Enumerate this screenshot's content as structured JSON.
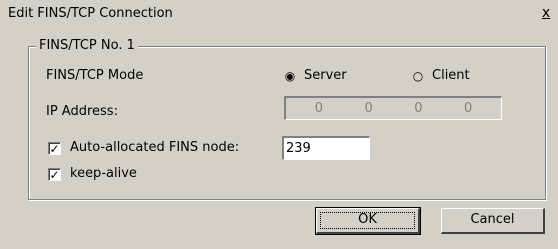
{
  "window": {
    "title": "Edit FINS/TCP Connection",
    "close_glyph": "x"
  },
  "group": {
    "label": "FINS/TCP No. 1"
  },
  "mode": {
    "label": "FINS/TCP Mode",
    "options": [
      {
        "label": "Server",
        "selected": true
      },
      {
        "label": "Client",
        "selected": false
      }
    ]
  },
  "ip": {
    "label": "IP Address:",
    "octets": [
      "0",
      "0",
      "0",
      "0"
    ],
    "enabled": false
  },
  "auto_node": {
    "label": "Auto-allocated FINS node:",
    "checked": true,
    "value": "239"
  },
  "keep_alive": {
    "label": "keep-alive",
    "checked": true
  },
  "buttons": {
    "ok": "OK",
    "cancel": "Cancel"
  },
  "colors": {
    "face": "#d4d0c8",
    "shadow": "#808080",
    "highlight": "#ffffff"
  }
}
